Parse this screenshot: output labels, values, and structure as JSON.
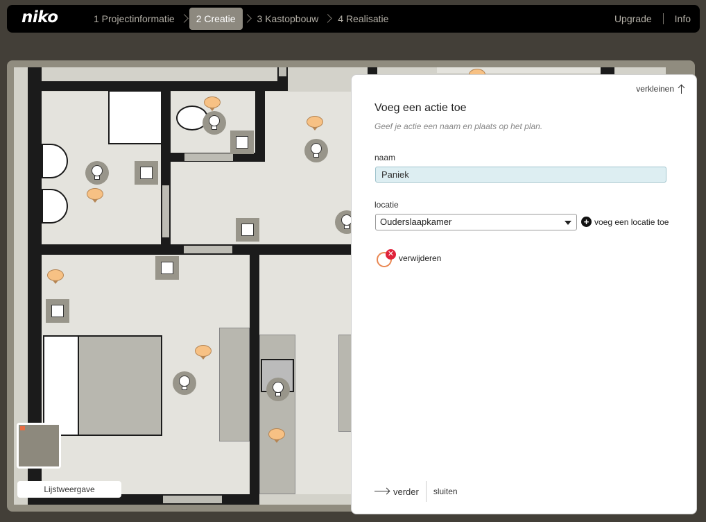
{
  "brand": {
    "logo_text": "niko"
  },
  "nav": {
    "steps": [
      {
        "label": "1 Projectinformatie",
        "active": false
      },
      {
        "label": "2 Creatie",
        "active": true
      },
      {
        "label": "3 Kastopbouw",
        "active": false
      },
      {
        "label": "4 Realisatie",
        "active": false
      }
    ],
    "upgrade_label": "Upgrade",
    "info_label": "Info"
  },
  "plan": {
    "list_view_label": "Lijstweergave"
  },
  "panel": {
    "collapse_label": "verkleinen",
    "title": "Voeg een actie toe",
    "subtitle": "Geef je actie een naam en plaats op het plan.",
    "name_label": "naam",
    "name_value": "Paniek",
    "location_label": "locatie",
    "location_value": "Ouderslaapkamer",
    "add_location_label": "voeg een locatie toe",
    "remove_label": "verwijderen",
    "next_label": "verder",
    "close_label": "sluiten"
  },
  "icons": {
    "switch": "wall-switch-icon",
    "lamp": "light-bulb-icon",
    "speech": "speech-bubble-icon"
  },
  "colors": {
    "accent_orange": "#f7c184",
    "nav_active": "#8d897f",
    "input_bg": "#ddeef2",
    "remove_red": "#e0223a"
  }
}
